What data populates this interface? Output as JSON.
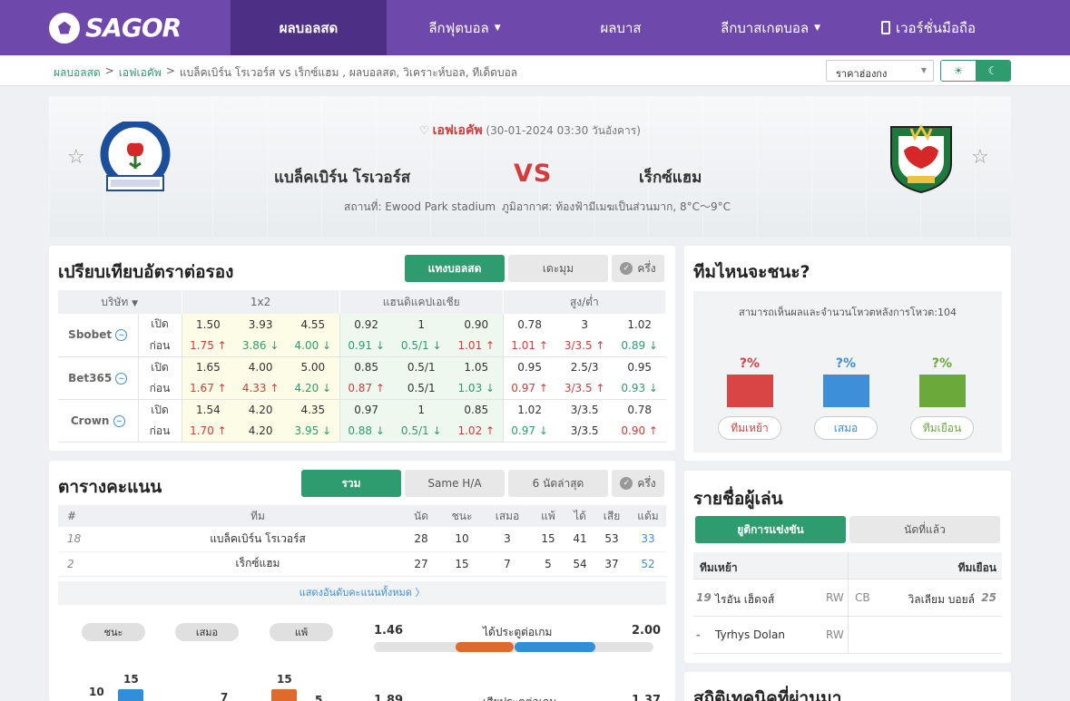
{
  "nav": {
    "logo": "SAGOR",
    "items": [
      {
        "label": "ผลบอลสด",
        "caret": false
      },
      {
        "label": "ลีกฟุตบอล",
        "caret": true
      },
      {
        "label": "ผลบาส",
        "caret": false
      },
      {
        "label": "ลีกบาสเกตบอล",
        "caret": true
      },
      {
        "label": "เวอร์ชั่นมือถือ",
        "caret": false
      }
    ]
  },
  "breadcrumb": {
    "home": "ผลบอลสด",
    "league": "เอฟเอคัพ",
    "rest": "แบล็คเบิร์น โรเวอร์ส vs  เร็กซ์แฮม ,  ผลบอลสด,  วิเคราะห์บอล,  ทีเด็ดบอล",
    "sep": ">"
  },
  "region_select": "ราคาฮ่องกง",
  "match": {
    "league": "เอฟเอคัพ",
    "datetime": "(30-01-2024 03:30 วันอังคาร)",
    "home": "แบล็คเบิร์น โรเวอร์ส",
    "away": "เร็กซ์แฮม",
    "vs": "VS",
    "stadium": "สถานที่: Ewood Park stadium",
    "weather": "ภูมิอากาศ: ท้องฟ้ามีเมฆเป็นส่วนมาก, 8°C～9°C",
    "home_crest_text": "BLACKBURN ROVERS F.C. · ARTE ET LABORE",
    "away_crest_text": "WREXHAM A.F.C."
  },
  "odds": {
    "title": "เปรียบเทียบอัตราต่อรอง",
    "buttons": [
      "แทงบอลสด",
      "เดะมุม",
      "ครึ่ง"
    ],
    "headers": [
      "บริษัท",
      "1x2",
      "แฮนดิแคปเอเชีย",
      "สูง/ต่ำ"
    ],
    "open_label": "เปิด",
    "close_label": "ก่อน",
    "companies": [
      {
        "name": "Sbobet",
        "open": [
          "1.50",
          "3.93",
          "4.55",
          "0.92",
          "1",
          "0.90",
          "0.78",
          "3",
          "1.02"
        ],
        "close": [
          "1.75",
          "3.86",
          "4.00",
          "0.91",
          "0.5/1",
          "1.01",
          "1.01",
          "3/3.5",
          "0.89"
        ],
        "dir": [
          "up",
          "dn",
          "dn",
          "dn",
          "dn",
          "up",
          "up",
          "up",
          "dn"
        ]
      },
      {
        "name": "Bet365",
        "open": [
          "1.65",
          "4.00",
          "5.00",
          "0.85",
          "0.5/1",
          "1.05",
          "0.95",
          "2.5/3",
          "0.95"
        ],
        "close": [
          "1.67",
          "4.33",
          "4.20",
          "0.87",
          "0.5/1",
          "1.03",
          "0.97",
          "3/3.5",
          "0.93"
        ],
        "dir": [
          "up",
          "up",
          "dn",
          "up",
          "",
          "dn",
          "up",
          "up",
          "dn"
        ]
      },
      {
        "name": "Crown",
        "open": [
          "1.54",
          "4.20",
          "4.35",
          "0.97",
          "1",
          "0.85",
          "1.02",
          "3/3.5",
          "0.78"
        ],
        "close": [
          "1.70",
          "4.20",
          "3.95",
          "0.88",
          "0.5/1",
          "1.02",
          "0.97",
          "3/3.5",
          "0.90"
        ],
        "dir": [
          "up",
          "",
          "dn",
          "dn",
          "dn",
          "up",
          "dn",
          "",
          "up"
        ]
      }
    ]
  },
  "winner": {
    "title": "ทีมไหนจะชนะ?",
    "note": "สามารถเห็นผลและจำนวนโหวตหลังการโหวต:104",
    "options": [
      {
        "pct": "?%",
        "label": "ทีมเหย้า",
        "color": "#d94444"
      },
      {
        "pct": "?%",
        "label": "เสมอ",
        "color": "#3d8fd9"
      },
      {
        "pct": "?%",
        "label": "ทีมเยือน",
        "color": "#6aaa3a"
      }
    ]
  },
  "standings": {
    "title": "ตารางคะแนน",
    "buttons": [
      "รวม",
      "Same H/A",
      "6 นัดล่าสุด",
      "ครึ่ง"
    ],
    "headers": [
      "#",
      "ทีม",
      "นัด",
      "ชนะ",
      "เสมอ",
      "แพ้",
      "ได้",
      "เสีย",
      "แต้ม"
    ],
    "rows": [
      [
        "18",
        "แบล็คเบิร์น โรเวอร์ส",
        "28",
        "10",
        "3",
        "15",
        "41",
        "53",
        "33"
      ],
      [
        "2",
        "เร็กซ์แฮม",
        "27",
        "15",
        "7",
        "5",
        "54",
        "37",
        "52"
      ]
    ],
    "show_all": "แสดงอันดับคะแนนทั้งหมด  〉"
  },
  "stats": {
    "pills": [
      "ชนะ",
      "เสมอ",
      "แพ้"
    ],
    "goals_label": "ได้ประตูต่อเกม",
    "goals_home": "1.46",
    "goals_away": "2.00",
    "goals_home_share": 0.42,
    "bar_values": [
      "10",
      "15",
      "7",
      "15",
      "5"
    ],
    "next_home": "1.89",
    "next_away": "1.37",
    "next_label": "เสียประตูต่อเกม"
  },
  "players": {
    "title": "รายชื่อผู้เล่น",
    "tabs": [
      "ยูติการแข่งขัน",
      "นัดที่แล้ว"
    ],
    "home_label": "ทีมเหย้า",
    "away_label": "ทีมเยือน",
    "rows": [
      {
        "num": "19",
        "name": "ไรอัน เฮ็ดจส์",
        "pos": "RW",
        "apos": "CB",
        "aname": "วิลเลียม บอยล์",
        "anum": "25"
      },
      {
        "num": "-",
        "name": "Tyrhys Dolan",
        "pos": "RW",
        "apos": "",
        "aname": "",
        "anum": ""
      }
    ]
  },
  "tech": {
    "title": "สถิติเทคนิคที่ผ่านมา"
  }
}
